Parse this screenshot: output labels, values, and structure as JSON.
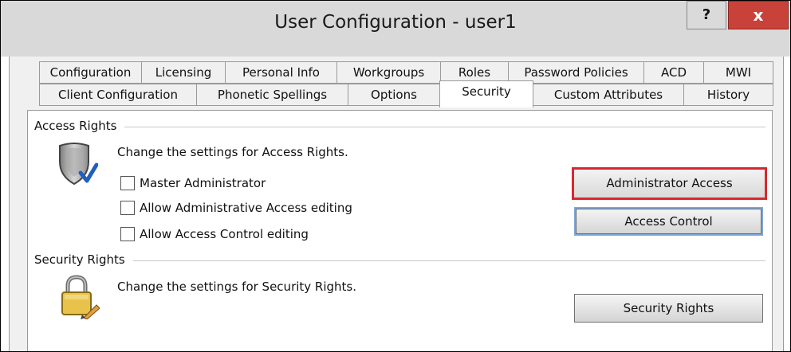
{
  "window": {
    "title": "User Configuration - user1",
    "help_label": "?",
    "close_label": "x"
  },
  "tabs": {
    "row1": [
      "Configuration",
      "Licensing",
      "Personal Info",
      "Workgroups",
      "Roles",
      "Password Policies",
      "ACD",
      "MWI"
    ],
    "row2": [
      "Client Configuration",
      "Phonetic Spellings",
      "Options",
      "Security",
      "Custom Attributes",
      "History"
    ],
    "active": "Security"
  },
  "access_rights": {
    "heading": "Access Rights",
    "description": "Change the settings for Access Rights.",
    "icon": "shield-icon",
    "checkboxes": [
      {
        "label": "Master Administrator",
        "checked": false
      },
      {
        "label": "Allow Administrative Access editing",
        "checked": false
      },
      {
        "label": "Allow Access Control editing",
        "checked": false
      }
    ],
    "buttons": {
      "administrator_access": "Administrator Access",
      "access_control": "Access Control"
    }
  },
  "security_rights": {
    "heading": "Security Rights",
    "description": "Change the settings for Security Rights.",
    "icon": "lock-icon",
    "button": "Security Rights"
  },
  "colors": {
    "highlight_border": "#d9272f",
    "close_button": "#c9423a",
    "titlebar": "#d9d9d9"
  }
}
